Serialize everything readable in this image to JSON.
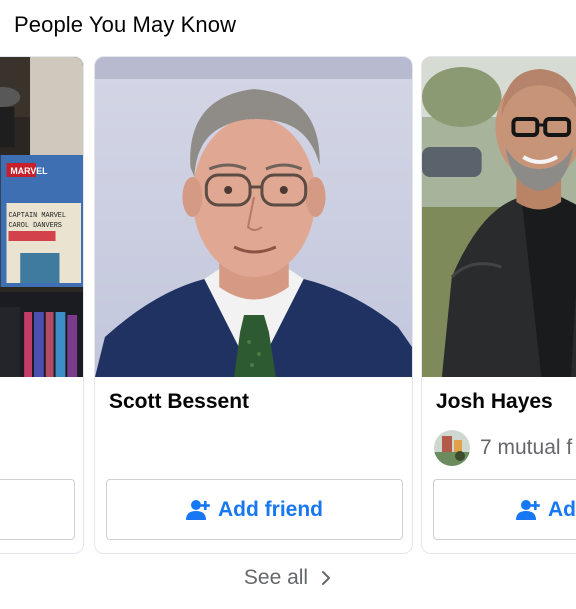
{
  "section": {
    "title": "People You May Know"
  },
  "cards": [
    {
      "name": "",
      "photo": "bookshelf-marvel-photo",
      "action_label": "",
      "mutual": ""
    },
    {
      "name": "Scott Bessent",
      "photo": "man-portrait-photo",
      "action_label": "Add friend",
      "mutual": ""
    },
    {
      "name": "Josh Hayes",
      "photo": "man-leather-jacket-photo",
      "action_label": "Add friend",
      "mutual": "7 mutual f"
    }
  ],
  "footer": {
    "see_all_label": "See all"
  },
  "colors": {
    "accent": "#1877f2",
    "secondary_text": "#65676b",
    "border": "#ced0d4"
  },
  "icons": {
    "add_friend": "person-plus-icon",
    "see_all": "chevron-right-icon"
  }
}
